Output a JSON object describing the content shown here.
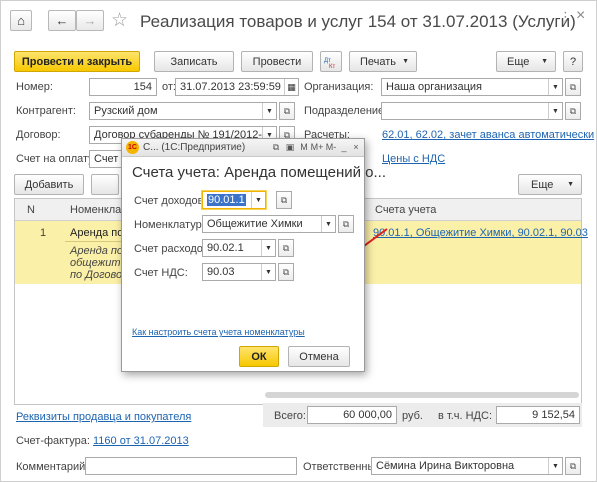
{
  "header": {
    "title": "Реализация товаров и услуг 154 от 31.07.2013 (Услуги)",
    "star": "☆",
    "home": "⌂",
    "back": "←",
    "forward": "→",
    "more_dots": "⋮",
    "close": "×"
  },
  "toolbar": {
    "post_close": "Провести и закрыть",
    "save": "Записать",
    "post": "Провести",
    "print": "Печать",
    "more": "Еще",
    "help": "?"
  },
  "form": {
    "number_label": "Номер:",
    "number_value": "154",
    "date_label": "от:",
    "date_value": "31.07.2013 23:59:59",
    "org_label": "Организация:",
    "org_value": "Наша организация",
    "contractor_label": "Контрагент:",
    "contractor_value": "Рузский дом",
    "division_label": "Подразделение:",
    "division_value": "",
    "contract_label": "Договор:",
    "contract_value": "Договор субаренды № 191/2012-Ю от 26",
    "calc_label": "Расчеты:",
    "calc_link": "62.01, 62.02, зачет аванса автоматически",
    "invoice_label": "Счет на оплату:",
    "invoice_value": "Счет н",
    "vat_link": "Цены с НДС"
  },
  "table_toolbar": {
    "add": "Добавить",
    "more": "Еще"
  },
  "table": {
    "headers": {
      "n": "N",
      "nomenclature": "Номенклату",
      "accounts": "Счета учета"
    },
    "rows": [
      {
        "n": "1",
        "nomenclature": "Аренда пом",
        "content_line1": "Аренда пом",
        "content_line2": "общежития",
        "content_line3": "по Договору",
        "accounts": "90.01.1, Общежитие Химки, 90.02.1, 90.03"
      }
    ]
  },
  "footer": {
    "requisites_link": "Реквизиты продавца и покупателя",
    "total_label": "Всего:",
    "total_value": "60 000,00",
    "currency": "руб.",
    "vat_label": "в т.ч. НДС:",
    "vat_value": "9 152,54",
    "invoice_label": "Счет-фактура:",
    "invoice_link": "1160 от 31.07.2013",
    "comment_label": "Комментарий:",
    "comment_value": "",
    "responsible_label": "Ответственный:",
    "responsible_value": "Сёмина Ирина Викторовна"
  },
  "dialog": {
    "bar_title": "С... (1С:Предприятие)",
    "title": "Счета учета: Аренда помещений о...",
    "income_label": "Счет доходов:",
    "income_value": "90.01.1",
    "nomen_label": "Номенклатур...",
    "nomen_value": "Общежитие Химки",
    "expense_label": "Счет расходов:",
    "expense_value": "90.02.1",
    "vat_label": "Счет НДС:",
    "vat_value": "90.03",
    "setup_link": "Как настроить счета учета номенклатуры",
    "ok": "ОК",
    "cancel": "Отмена"
  },
  "colors": {
    "accent_yellow": "#f7c800",
    "row_highlight": "#fbf0a8",
    "link_blue": "#1d64b0",
    "arrow_red": "#e02020"
  }
}
